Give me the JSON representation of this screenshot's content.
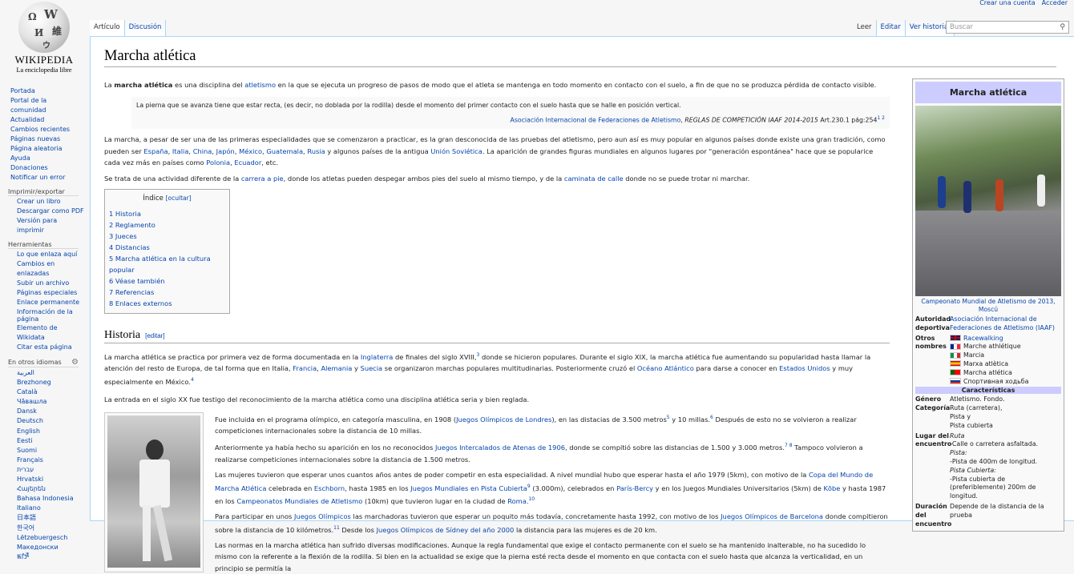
{
  "logo": {
    "wordmark": "Wikipedia",
    "tagline": "La enciclopedia libre",
    "globe_glyphs": [
      "Ω",
      "W",
      "維",
      "И",
      "ウ"
    ]
  },
  "personal": {
    "create": "Crear una cuenta",
    "login": "Acceder"
  },
  "tabs": {
    "article": "Artículo",
    "talk": "Discusión",
    "read": "Leer",
    "edit": "Editar",
    "history": "Ver historial"
  },
  "search": {
    "placeholder": "Buscar",
    "icon": "search-icon"
  },
  "sidebar": {
    "nav": [
      "Portada",
      "Portal de la comunidad",
      "Actualidad",
      "Cambios recientes",
      "Páginas nuevas",
      "Página aleatoria",
      "Ayuda",
      "Donaciones",
      "Notificar un error"
    ],
    "print_heading": "Imprimir/exportar",
    "print": [
      "Crear un libro",
      "Descargar como PDF",
      "Versión para imprimir"
    ],
    "tools_heading": "Herramientas",
    "tools": [
      "Lo que enlaza aquí",
      "Cambios en enlazadas",
      "Subir un archivo",
      "Páginas especiales",
      "Enlace permanente",
      "Información de la página",
      "Elemento de Wikidata",
      "Citar esta página"
    ],
    "langs_heading": "En otros idiomas",
    "langs": [
      "العربية",
      "Brezhoneg",
      "Català",
      "Чӑвашла",
      "Dansk",
      "Deutsch",
      "English",
      "Eesti",
      "Suomi",
      "Français",
      "עברית",
      "Hrvatski",
      "Հայերեն",
      "Bahasa Indonesia",
      "Italiano",
      "日本語",
      "한국어",
      "Lëtzebuergesch",
      "Македонски",
      "ꯃꯤꯇꯩ"
    ]
  },
  "article": {
    "title": "Marcha atlética",
    "intro": [
      "La ",
      "marcha atlética",
      " es una disciplina del ",
      "atletismo",
      " en la que se ejecuta un progreso de pasos de modo que el atleta se mantenga en todo momento en contacto con el suelo, a fin de que no se produzca pérdida de contacto visible."
    ],
    "quote": "La pierna que se avanza tiene que estar recta, (es decir, no doblada por la rodilla) desde el momento del primer contacto con el suelo hasta que se halle en posición vertical.",
    "quote_cite": [
      "Asociación Internacional de Federaciones de Atletismo",
      ", ",
      "REGLAS DE COMPETICIÓN IAAF 2014-2015",
      " Art.230.1 pág:254",
      "1 2"
    ],
    "p2": [
      "La marcha, a pesar de ser una de las primeras especialidades que se comenzaron a practicar, es la gran desconocida de las pruebas del atletismo, pero aun así es muy popular en algunos países donde existe una gran tradición, como pueden ser ",
      "España",
      ", ",
      "Italia",
      ", ",
      "China",
      ", ",
      "Japón",
      ", ",
      "México",
      ", ",
      "Guatemala",
      ", ",
      "Rusia",
      " y algunos países de la antigua ",
      "Unión Soviética",
      ". La aparición de grandes figuras mundiales en algunos lugares por \"generación espontánea\" hace que se popularice cada vez más en países como ",
      "Polonia",
      ", ",
      "Ecuador",
      ", etc."
    ],
    "p3": [
      "Se trata de una actividad diferente de la ",
      "carrera a pie",
      ", donde los atletas pueden despegar ambos pies del suelo al mismo tiempo, y de la ",
      "caminata de calle",
      " donde no se puede trotar ni marchar."
    ],
    "toc": {
      "title": "Índice",
      "toggle": "[ocultar]",
      "items": [
        "1 Historia",
        "2 Reglamento",
        "3 Jueces",
        "4 Distancias",
        "5 Marcha atlética en la cultura popular",
        "6 Véase también",
        "7 Referencias",
        "8 Enlaces externos"
      ]
    },
    "h2": "Historia",
    "h2_edit": "[editar]",
    "h1p": [
      "La marcha atlética se practica por primera vez de forma documentada en la ",
      "Inglaterra",
      " de finales del siglo XVIII,",
      "3",
      " donde se hicieron populares. Durante el siglo XIX, la marcha atlética fue aumentando su popularidad hasta llamar la atención del resto de Europa, de tal forma que en Italia, ",
      "Francia",
      ", ",
      "Alemania",
      " y ",
      "Suecia",
      " se organizaron marchas populares multitudinarias. Posteriormente cruzó el ",
      "Océano Atlántico",
      " para darse a conocer en ",
      "Estados Unidos",
      " y muy especialmente en México.",
      "4"
    ],
    "h2p": "La entrada en el siglo XX fue testigo del reconocimiento de la marcha atlética como una disciplina atlética seria y bien reglada.",
    "h3p": [
      "Fue incluida en el programa olímpico, en categoría masculina, en 1908 (",
      "Juegos Olímpicos de Londres",
      "), en las distacias de 3.500 metros",
      "5",
      " y 10 millas.",
      "6",
      " Después de esto no se volvieron a realizar competiciones internacionales sobre la distancia de 10 millas."
    ],
    "h4p": [
      "Anteriormente ya había hecho su aparición en los no reconocidos ",
      "Juegos Intercalados de Atenas de 1906",
      ", donde se compitió sobre las distancias de 1.500 y 3.000 metros.",
      "7 8",
      " Tampoco volvieron a realizarse competiciones internacionales sobre la distancia de 1.500 metros."
    ],
    "h5p": [
      "Las mujeres tuvieron que esperar unos cuantos años antes de poder competir en esta especialidad. A nivel mundial hubo que esperar hasta el año 1979 (5km), con motivo de la ",
      "Copa del Mundo de Marcha Atlética",
      " celebrada en ",
      "Eschborn",
      ", hasta 1985 en los ",
      "Juegos Mundiales en Pista Cubierta",
      "9",
      " (3.000m), celebrados en ",
      "París-Bercy",
      " y en los Juegos Mundiales Universitarios (5km) de ",
      "Kōbe",
      " y hasta 1987 en los ",
      "Campeonatos Mundiales de Atletismo",
      " (10km) que tuvieron lugar en la ciudad de ",
      "Roma",
      ".",
      "10"
    ],
    "h6p": [
      "Para participar en unos ",
      "Juegos Olímpicos",
      " las marchadoras tuvieron que esperar un poquito más todavía, concretamente hasta 1992, con motivo de los ",
      "Juegos Olímpicos de Barcelona",
      " donde compitieron sobre la distancia de 10 kilómetros.",
      "11",
      " Desde los ",
      "Juegos Olímpicos de Sídney del año 2000",
      " la distancia para las mujeres es de 20 km."
    ],
    "h7p": "Las normas en la marcha atlética han sufrido diversas modificaciones. Aunque la regla fundamental que exige el contacto permanente con el suelo se ha mantenido inalterable, no ha sucedido lo mismo con la referente a la flexión de la rodilla. Si bien en la actualidad se exige que la pierna esté recta desde el momento en que contacta con el suelo hasta que alcanza la verticalidad, en un principio se permitía la"
  },
  "infobox": {
    "title": "Marcha atlética",
    "caption": "Campeonato Mundial de Atletismo de 2013, Moscú",
    "authority_k": "Autoridad deportiva",
    "authority_v": "Asociación Internacional de Federaciones de Atletismo (IAAF)",
    "names_k": "Otros nombres",
    "names": [
      {
        "flag": "uk",
        "text": "Racewalking",
        "link": true
      },
      {
        "flag": "fr",
        "text": "Marche athlétique"
      },
      {
        "flag": "it",
        "text": "Marcia"
      },
      {
        "flag": "es",
        "text": "Marxa atlètica"
      },
      {
        "flag": "pt",
        "text": "Marcha atlética"
      },
      {
        "flag": "ru",
        "text": "Спортивная ходьба"
      }
    ],
    "section": "Características",
    "genre_k": "Género",
    "genre_v": "Atletismo. Fondo.",
    "cat_k": "Categoría",
    "cat_v": [
      "Ruta (carretera),",
      "Pista y",
      "Pista cubierta"
    ],
    "place_k": "Lugar del encuentro",
    "place_v": [
      {
        "t": "Ruta",
        "i": true
      },
      {
        "t": "-Calle o carretera asfaltada."
      },
      {
        "t": "Pista:",
        "i": true
      },
      {
        "t": "-Pista de 400m de longitud."
      },
      {
        "t": "Pista Cubierta:",
        "i": true
      },
      {
        "t": "-Pista cubierta de (preferiblemente) 200m de longitud."
      }
    ],
    "dur_k": "Duración del encuentro",
    "dur_v": "Depende de la distancia de la prueba"
  },
  "colors": {
    "link": "#0645ad",
    "infobox_header": "#ccccff",
    "border": "#a7d7f9"
  }
}
